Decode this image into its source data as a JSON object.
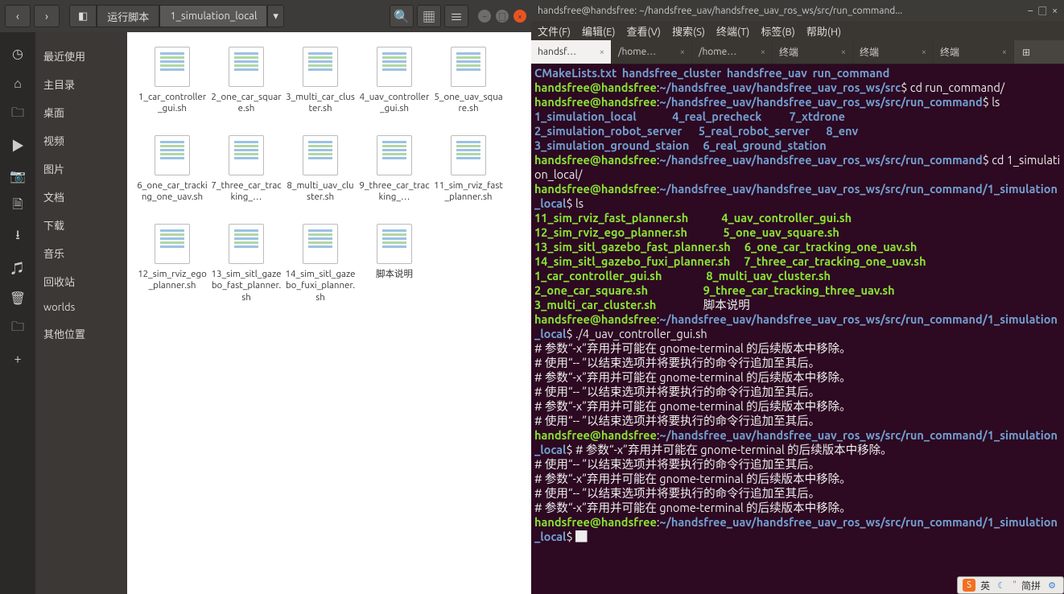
{
  "file_manager": {
    "breadcrumb": [
      "运行脚本",
      "1_simulation_local"
    ],
    "sidebar_places": [
      "最近使用",
      "主目录",
      "桌面",
      "视频",
      "图片",
      "文档",
      "下载",
      "音乐",
      "回收站",
      "worlds",
      "其他位置"
    ],
    "files": [
      "1_car_controller_gui.sh",
      "2_one_car_square.sh",
      "3_multi_car_cluster.sh",
      "4_uav_controller_gui.sh",
      "5_one_uav_square.sh",
      "6_one_car_tracking_one_uav.sh",
      "7_three_car_tracking_…",
      "8_multi_uav_cluster.sh",
      "9_three_car_tracking_…",
      "11_sim_rviz_fast_planner.sh",
      "12_sim_rviz_ego_planner.sh",
      "13_sim_sitl_gazebo_fast_planner.sh",
      "14_sim_sitl_gazebo_fuxi_planner.sh",
      "脚本说明"
    ]
  },
  "terminal": {
    "title": "handsfree@handsfree: ~/handsfree_uav/handsfree_uav_ros_ws/src/run_command...",
    "menus": [
      "文件(F)",
      "编辑(E)",
      "查看(V)",
      "搜索(S)",
      "终端(T)",
      "标签(B)",
      "帮助(H)"
    ],
    "tabs": [
      {
        "label": "handsf…",
        "active": true
      },
      {
        "label": "/home…",
        "active": false
      },
      {
        "label": "/home…",
        "active": false
      },
      {
        "label": "终端",
        "active": false
      },
      {
        "label": "终端",
        "active": false
      },
      {
        "label": "终端",
        "active": false
      }
    ],
    "ls_runcmd_col1": [
      "1_simulation_local",
      "2_simulation_robot_server",
      "3_simulation_ground_staion"
    ],
    "ls_runcmd_col2": [
      "4_real_precheck",
      "5_real_robot_server",
      "6_real_ground_station"
    ],
    "ls_runcmd_col3": [
      "7_xtdrone",
      "8_env"
    ],
    "ls_sim_col1": [
      "11_sim_rviz_fast_planner.sh",
      "12_sim_rviz_ego_planner.sh",
      "13_sim_sitl_gazebo_fast_planner.sh",
      "14_sim_sitl_gazebo_fuxi_planner.sh",
      "1_car_controller_gui.sh",
      "2_one_car_square.sh",
      "3_multi_car_cluster.sh"
    ],
    "ls_sim_col2": [
      "4_uav_controller_gui.sh",
      "5_one_uav_square.sh",
      "6_one_car_tracking_one_uav.sh",
      "7_three_car_tracking_one_uav.sh",
      "8_multi_uav_cluster.sh",
      "9_three_car_tracking_three_uav.sh",
      "脚本说明"
    ],
    "host": "handsfree@handsfree",
    "path_src": "~/handsfree_uav/handsfree_uav_ros_ws/src",
    "path_runcmd": "~/handsfree_uav/handsfree_uav_ros_ws/src/run_command",
    "path_simlocal": "~/handsfree_uav/handsfree_uav_ros_ws/src/run_command/1_simulation_local",
    "cmd_cd_runcmd": "cd run_command/",
    "cmd_ls": "ls",
    "cmd_cd_sim": "cd 1_simulation_local/",
    "cmd_run": "./4_uav_controller_gui.sh",
    "cmd_echo": "# 参数“-x”弃用并可能在 gnome-terminal 的后续版本中移除。",
    "first_line_items": [
      "CMakeLists.txt",
      "handsfree_cluster",
      "handsfree_uav",
      "run_command"
    ],
    "warn_lines": [
      "# 参数“-x”弃用并可能在 gnome-terminal 的后续版本中移除。",
      "# 使用“-- ”以结束选项并将要执行的命令行追加至其后。",
      "# 参数“-x”弃用并可能在 gnome-terminal 的后续版本中移除。",
      "# 使用“-- ”以结束选项并将要执行的命令行追加至其后。",
      "# 参数“-x”弃用并可能在 gnome-terminal 的后续版本中移除。",
      "# 使用“-- ”以结束选项并将要执行的命令行追加至其后。"
    ],
    "warn_lines2": [
      "# 使用“-- ”以结束选项并将要执行的命令行追加至其后。",
      "# 参数“-x”弃用并可能在 gnome-terminal 的后续版本中移除。",
      "# 使用“-- ”以结束选项并将要执行的命令行追加至其后。",
      "# 参数“-x”弃用并可能在 gnome-terminal 的后续版本中移除。"
    ]
  },
  "ime_bar": {
    "mode": "英",
    "layout": "简拼"
  }
}
